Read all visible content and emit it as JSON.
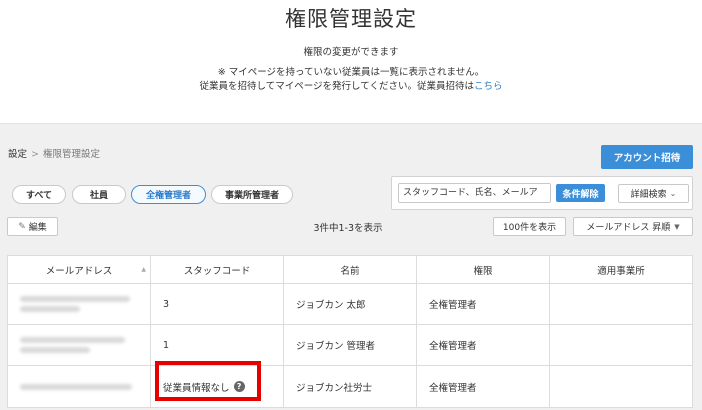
{
  "header": {
    "title": "権限管理設定",
    "subtitle": "権限の変更ができます",
    "note_line1": "※ マイページを持っていない従業員は一覧に表示されません。",
    "note_line2": "従業員を招待してマイページを発行してください。従業員招待は",
    "note_link": "こちら"
  },
  "breadcrumb": {
    "root": "設定",
    "separator": ">",
    "current": "権限管理設定"
  },
  "actions": {
    "invite_label": "アカウント招待"
  },
  "filters": {
    "pills": [
      {
        "label": "すべて",
        "active": false
      },
      {
        "label": "社員",
        "active": false
      },
      {
        "label": "全権管理者",
        "active": true
      },
      {
        "label": "事業所管理者",
        "active": false
      }
    ]
  },
  "search": {
    "placeholder": "スタッフコード、氏名、メールア",
    "clear_label": "条件解除",
    "detail_label": "詳細検索"
  },
  "toolbar": {
    "edit_label": "編集",
    "count_text": "3件中1-3を表示",
    "per_page_label": "100件を表示",
    "sort_label": "メールアドレス 昇順"
  },
  "table": {
    "columns": [
      "メールアドレス",
      "スタッフコード",
      "名前",
      "権限",
      "適用事業所"
    ],
    "rows": [
      {
        "staff_code": "3",
        "name": "ジョブカン 太郎",
        "role": "全権管理者",
        "office": ""
      },
      {
        "staff_code": "1",
        "name": "ジョブカン 管理者",
        "role": "全権管理者",
        "office": ""
      },
      {
        "staff_code": "従業員情報なし",
        "name": "ジョブカン社労士",
        "role": "全権管理者",
        "office": ""
      }
    ]
  },
  "icons": {
    "breadcrumb_separator": "chevron-right-icon",
    "detail": "chevron-down-icon",
    "edit": "pencil-icon",
    "sort": "triangle-down-icon",
    "help": "question-circle-icon"
  },
  "colors": {
    "primary": "#3b8fd9",
    "link": "#2a7ccc",
    "highlight": "#e60000"
  }
}
